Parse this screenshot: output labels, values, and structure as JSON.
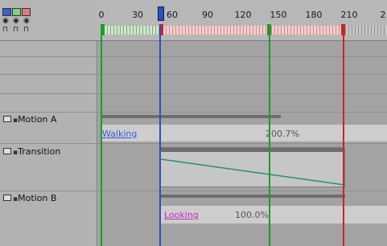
{
  "ruler": {
    "ticks": [
      "0",
      "30",
      "60",
      "90",
      "120",
      "150",
      "180",
      "210",
      "2"
    ]
  },
  "tracks": [
    {
      "name": "Motion A",
      "clip_label": "Walking",
      "clip_percent": "200.7%"
    },
    {
      "name": "Transition"
    },
    {
      "name": "Motion B",
      "clip_label": "Looking",
      "clip_percent": "100.0%"
    }
  ],
  "colors": {
    "playhead": "#2a4fc2",
    "marker_green": "#1f9a2a",
    "marker_red": "#c8252a",
    "walking_label": "#3a5bd6",
    "looking_label": "#c02abf",
    "transition_curve": "#2e8a76"
  },
  "icons": [
    "layer-color-swatch-blue",
    "layer-color-swatch-green",
    "layer-color-swatch-red",
    "eye-icon",
    "lock-icon"
  ]
}
